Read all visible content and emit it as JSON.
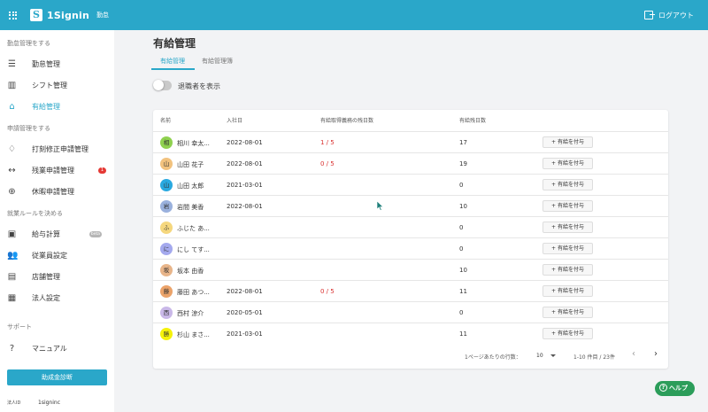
{
  "header": {
    "logo_mark": "S",
    "logo_text": "1Signin",
    "logo_sub": "勤怠",
    "logout_label": "ログアウト"
  },
  "sidebar": {
    "sections": [
      "勤怠管理をする",
      "申請管理をする",
      "就業ルールを決める",
      "サポート"
    ],
    "items": [
      {
        "label": "勤怠管理",
        "icon": "list-icon"
      },
      {
        "label": "シフト管理",
        "icon": "columns-icon"
      },
      {
        "label": "有給管理",
        "icon": "home-icon",
        "active": true
      },
      {
        "label": "打刻修正申請管理",
        "icon": "bell-icon"
      },
      {
        "label": "残業申請管理",
        "icon": "arrows-icon",
        "badge": "1"
      },
      {
        "label": "休暇申請管理",
        "icon": "plus-circle-icon"
      },
      {
        "label": "給与計算",
        "icon": "money-icon",
        "badge": "beta"
      },
      {
        "label": "従業員設定",
        "icon": "people-icon"
      },
      {
        "label": "店舗管理",
        "icon": "store-icon"
      },
      {
        "label": "法人設定",
        "icon": "building-icon"
      },
      {
        "label": "マニュアル",
        "icon": "help-circle-icon"
      }
    ],
    "subsidy_button": "助成金診断",
    "corp_label": "法人ID",
    "corp_value": "1signinc"
  },
  "page": {
    "title": "有給管理",
    "tabs": [
      "有給管理",
      "有給管理簿"
    ],
    "toggle_label": "退職者を表示"
  },
  "table": {
    "headers": [
      "名前",
      "入社日",
      "有給取得義務の残日数",
      "有給残日数"
    ],
    "grant_label": "+ 有給を付与",
    "rows": [
      {
        "initial": "相",
        "color": "#8fd14f",
        "name": "相川 幸太...",
        "date": "2022-08-01",
        "pending": "1 / 5",
        "remain": "17"
      },
      {
        "initial": "山",
        "color": "#f2c27e",
        "name": "山田 花子",
        "date": "2022-08-01",
        "pending": "0 / 5",
        "remain": "19"
      },
      {
        "initial": "山",
        "color": "#29a9e0",
        "name": "山田 太郎",
        "date": "2021-03-01",
        "pending": "",
        "remain": "0"
      },
      {
        "initial": "岩",
        "color": "#9ab1dd",
        "name": "岩間 美香",
        "date": "2022-08-01",
        "pending": "",
        "remain": "10"
      },
      {
        "initial": "ふ",
        "color": "#f5d77e",
        "name": "ふじた あ...",
        "date": "",
        "pending": "",
        "remain": "0"
      },
      {
        "initial": "に",
        "color": "#a4a9ee",
        "name": "にし てす...",
        "date": "",
        "pending": "",
        "remain": "0"
      },
      {
        "initial": "坂",
        "color": "#e8b58a",
        "name": "坂本 由香",
        "date": "",
        "pending": "",
        "remain": "10"
      },
      {
        "initial": "藤",
        "color": "#eba36a",
        "name": "藤田 あつ...",
        "date": "2022-08-01",
        "pending": "0 / 5",
        "remain": "11"
      },
      {
        "initial": "西",
        "color": "#c9b8e8",
        "name": "西村 涼介",
        "date": "2020-05-01",
        "pending": "",
        "remain": "0"
      },
      {
        "initial": "勝",
        "color": "#f5f20a",
        "name": "杉山 まさ...",
        "date": "2021-03-01",
        "pending": "",
        "remain": "11"
      }
    ],
    "footer": {
      "rows_per_page_label": "1ページあたりの行数：",
      "rows_per_page": "10",
      "range": "1-10 件目 / 23件",
      "prev": "‹",
      "next": "›"
    }
  },
  "help_button": "ヘルプ",
  "colors": {
    "accent": "#2aa7c9",
    "danger": "#d9302f",
    "help": "#2c9d5a"
  }
}
